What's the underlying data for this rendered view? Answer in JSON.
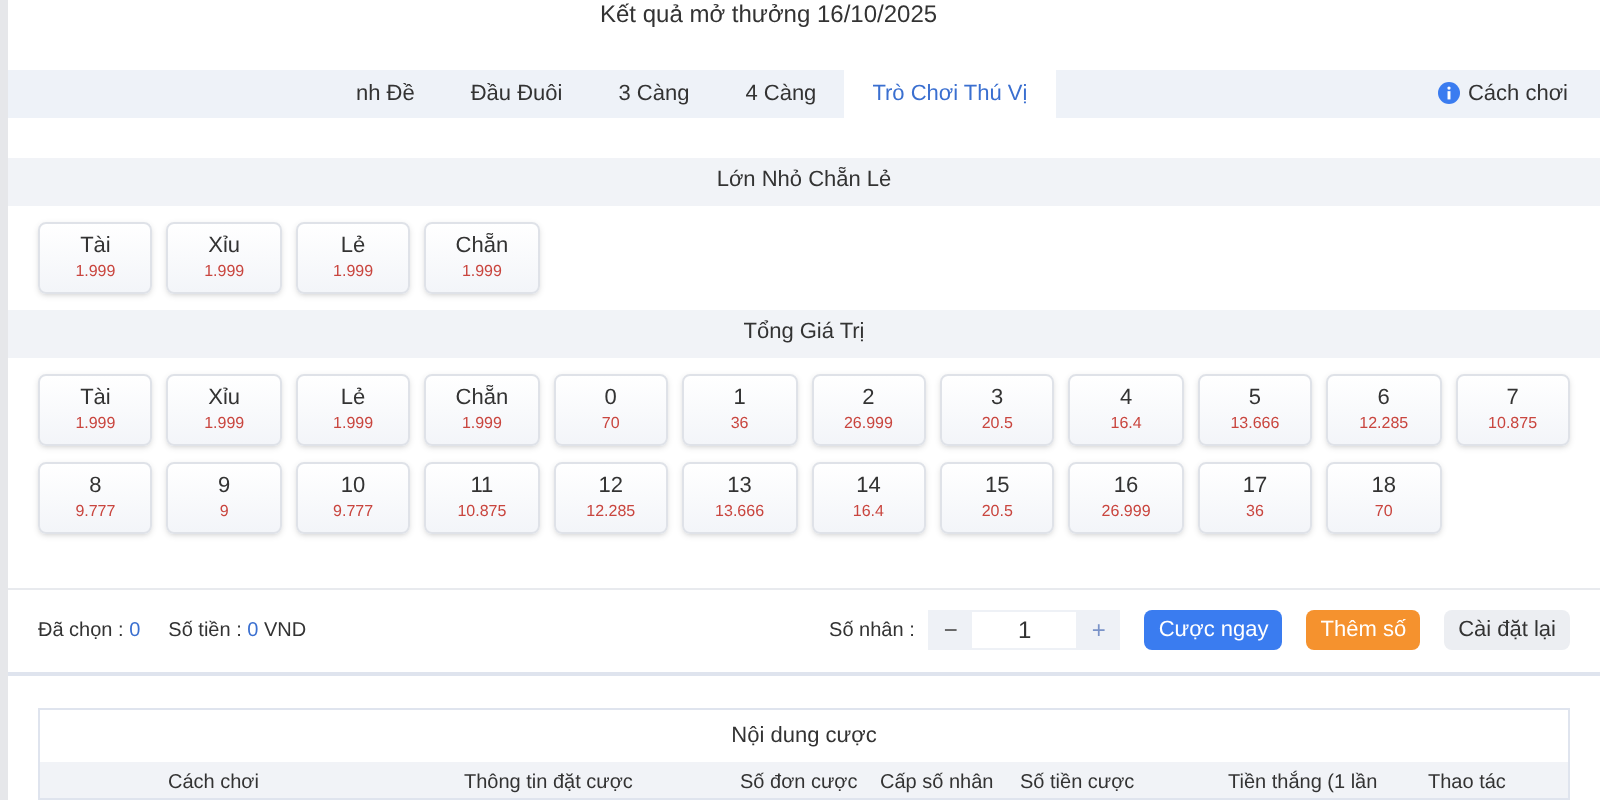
{
  "header": {
    "title": "Kết quả mở thưởng 16/10/2025"
  },
  "tabs": [
    {
      "label": "nh Đề",
      "selected": false
    },
    {
      "label": "Đầu Đuôi",
      "selected": false
    },
    {
      "label": "3 Càng",
      "selected": false
    },
    {
      "label": "4 Càng",
      "selected": false
    },
    {
      "label": "Trò Chơi Thú Vị",
      "selected": true
    }
  ],
  "help_link": "Cách chơi",
  "sections": [
    {
      "title": "Lớn Nhỏ Chẵn Lẻ",
      "options": [
        {
          "label": "Tài",
          "odds": "1.999"
        },
        {
          "label": "Xỉu",
          "odds": "1.999"
        },
        {
          "label": "Lẻ",
          "odds": "1.999"
        },
        {
          "label": "Chẵn",
          "odds": "1.999"
        }
      ]
    },
    {
      "title": "Tổng Giá Trị",
      "options": [
        {
          "label": "Tài",
          "odds": "1.999"
        },
        {
          "label": "Xỉu",
          "odds": "1.999"
        },
        {
          "label": "Lẻ",
          "odds": "1.999"
        },
        {
          "label": "Chẵn",
          "odds": "1.999"
        },
        {
          "label": "0",
          "odds": "70"
        },
        {
          "label": "1",
          "odds": "36"
        },
        {
          "label": "2",
          "odds": "26.999"
        },
        {
          "label": "3",
          "odds": "20.5"
        },
        {
          "label": "4",
          "odds": "16.4"
        },
        {
          "label": "5",
          "odds": "13.666"
        },
        {
          "label": "6",
          "odds": "12.285"
        },
        {
          "label": "7",
          "odds": "10.875"
        },
        {
          "label": "8",
          "odds": "9.777"
        },
        {
          "label": "9",
          "odds": "9"
        },
        {
          "label": "10",
          "odds": "9.777"
        },
        {
          "label": "11",
          "odds": "10.875"
        },
        {
          "label": "12",
          "odds": "12.285"
        },
        {
          "label": "13",
          "odds": "13.666"
        },
        {
          "label": "14",
          "odds": "16.4"
        },
        {
          "label": "15",
          "odds": "20.5"
        },
        {
          "label": "16",
          "odds": "26.999"
        },
        {
          "label": "17",
          "odds": "36"
        },
        {
          "label": "18",
          "odds": "70"
        }
      ]
    }
  ],
  "summary": {
    "selected_label": "Đã chọn :",
    "selected_value": "0",
    "amount_label": "Số tiền :",
    "amount_value": "0",
    "currency": "VND"
  },
  "multiplier": {
    "label": "Số nhân :",
    "minus": "−",
    "value": "1",
    "plus": "+"
  },
  "buttons": [
    {
      "label": "Cược ngay",
      "kind": "primary"
    },
    {
      "label": "Thêm số",
      "kind": "accent"
    },
    {
      "label": "Cài đặt lại",
      "kind": "plain"
    }
  ],
  "bets_panel": {
    "title": "Nội dung cược",
    "columns": [
      "Cách chơi",
      "Thông tin đặt cược",
      "Số đơn cược",
      "Cấp số nhân",
      "Số tiền cược",
      "Tiền thắng (1 lần",
      "Thao tác"
    ]
  }
}
